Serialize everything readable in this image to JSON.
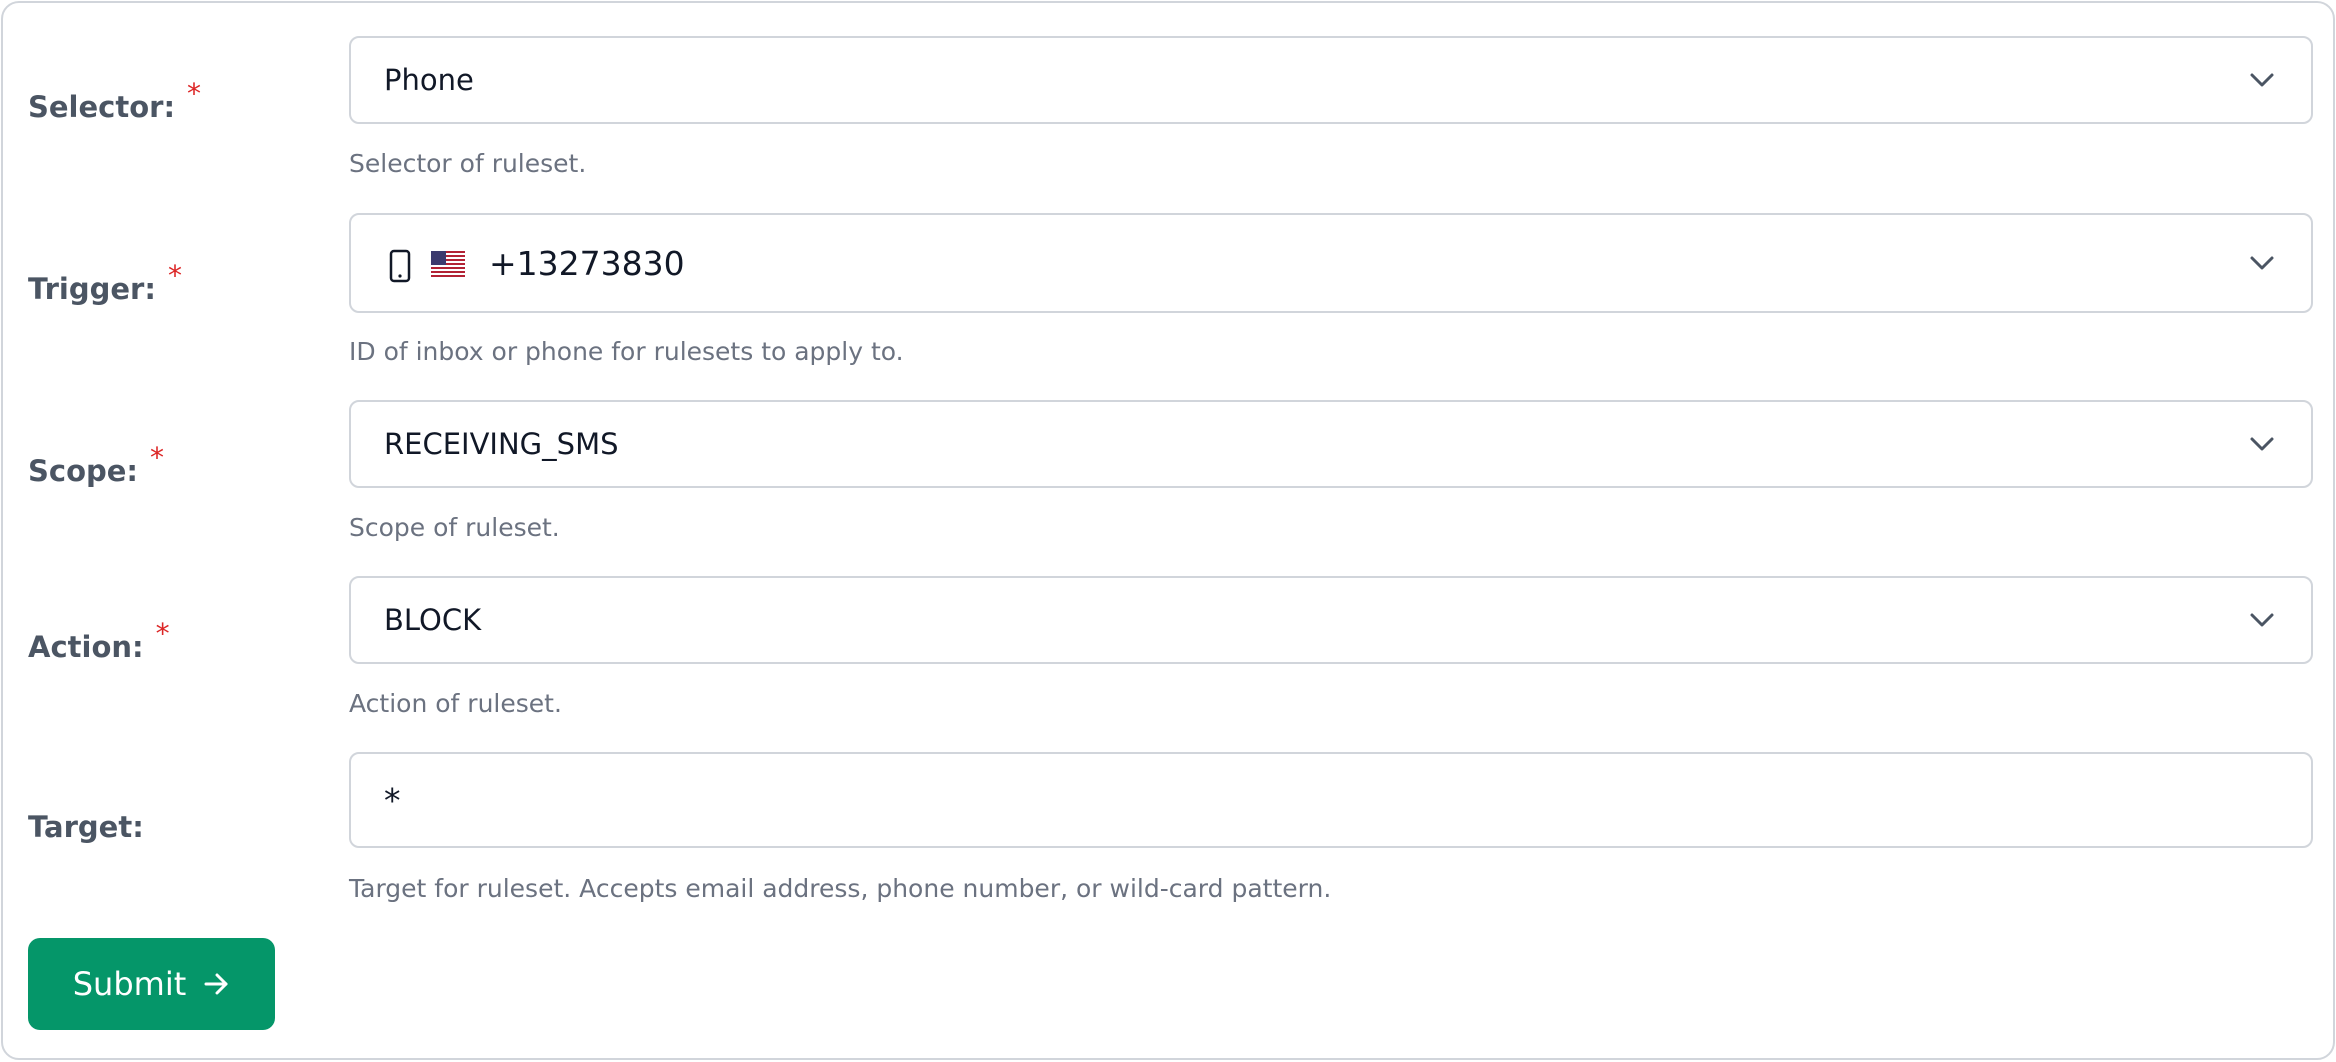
{
  "form": {
    "selector": {
      "label": "Selector:",
      "required_mark": "*",
      "value": "Phone",
      "help": "Selector of ruleset."
    },
    "trigger": {
      "label": "Trigger:",
      "required_mark": "*",
      "value": "+13273830",
      "icon": "phone-icon",
      "flag": "us-flag-icon",
      "help": "ID of inbox or phone for rulesets to apply to."
    },
    "scope": {
      "label": "Scope:",
      "required_mark": "*",
      "value": "RECEIVING_SMS",
      "help": "Scope of ruleset."
    },
    "action": {
      "label": "Action:",
      "required_mark": "*",
      "value": "BLOCK",
      "help": "Action of ruleset."
    },
    "target": {
      "label": "Target:",
      "value": "*",
      "help": "Target for ruleset. Accepts email address, phone number, or wild-card pattern."
    },
    "submit_label": "Submit",
    "submit_icon": "arrow-right-icon"
  },
  "colors": {
    "accent": "#059669",
    "required": "#dc2626",
    "label": "#4b5563",
    "help": "#6b7280",
    "border": "#d1d5db"
  }
}
